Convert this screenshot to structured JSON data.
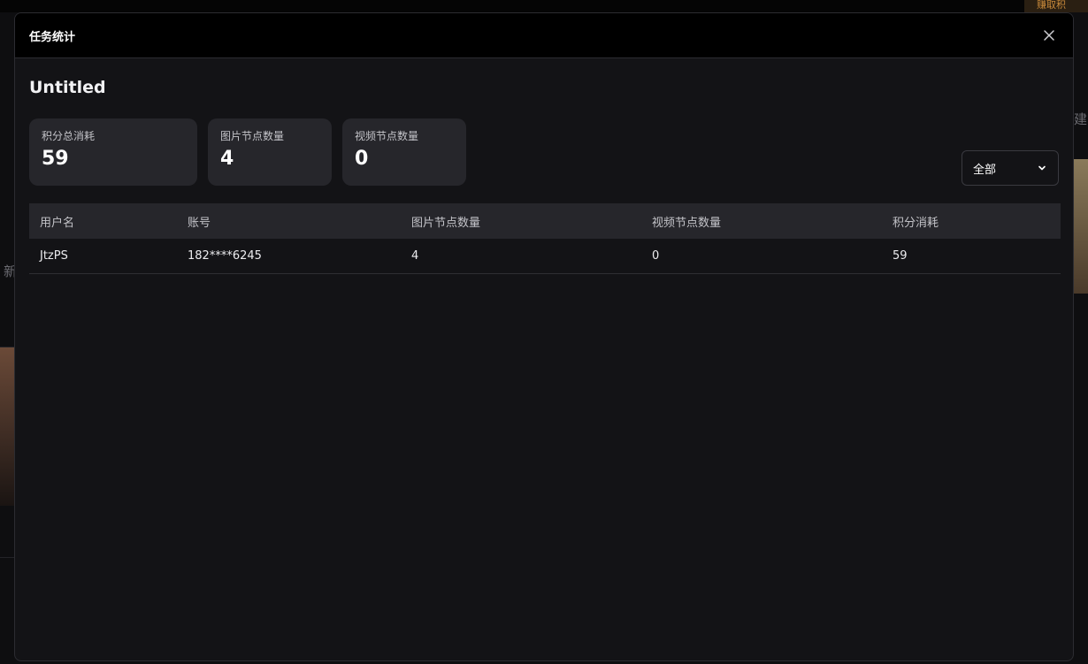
{
  "background": {
    "earn_label": "赚取积",
    "left_snippet": "新",
    "right_snippet": "建"
  },
  "modal": {
    "title": "任务统计",
    "document_title": "Untitled"
  },
  "stats": [
    {
      "label": "积分总消耗",
      "value": "59"
    },
    {
      "label": "图片节点数量",
      "value": "4"
    },
    {
      "label": "视频节点数量",
      "value": "0"
    }
  ],
  "filter": {
    "selected": "全部"
  },
  "table": {
    "columns": [
      "用户名",
      "账号",
      "图片节点数量",
      "视频节点数量",
      "积分消耗"
    ],
    "rows": [
      [
        "JtzPS",
        "182****6245",
        "4",
        "0",
        "59"
      ]
    ]
  },
  "colors": {
    "modal_bg": "#131316",
    "header_bg": "#000000",
    "card_bg": "#26262b"
  }
}
